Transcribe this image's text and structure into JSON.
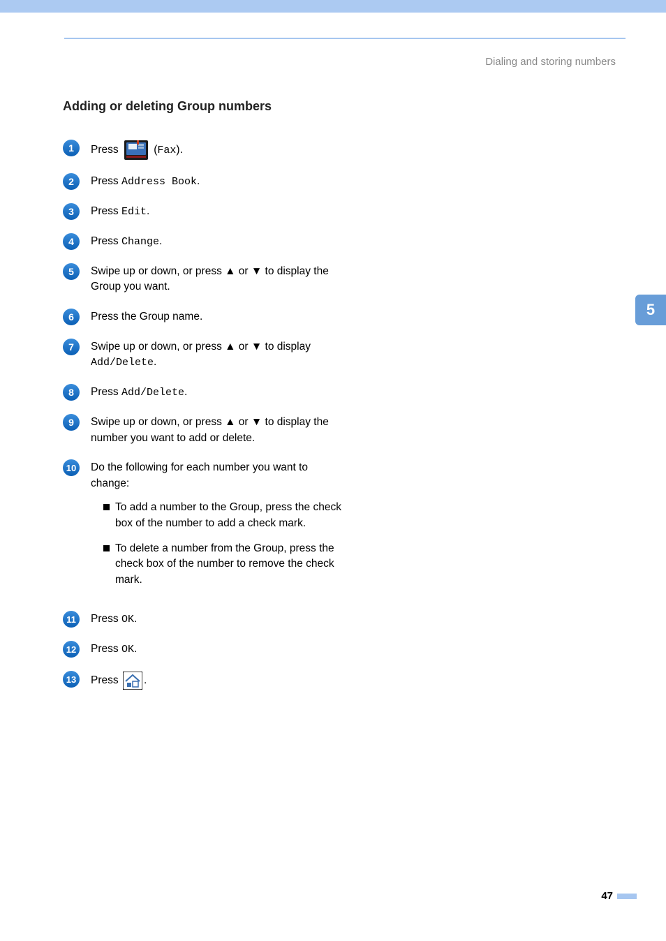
{
  "header": {
    "breadcrumb": "Dialing and storing numbers"
  },
  "section": {
    "title": "Adding or deleting Group numbers"
  },
  "steps": [
    {
      "num": "1",
      "prefix": "Press ",
      "fax_icon": true,
      "middle": " (",
      "code": "Fax",
      "suffix": ")."
    },
    {
      "num": "2",
      "prefix": "Press ",
      "code": "Address Book",
      "suffix": "."
    },
    {
      "num": "3",
      "prefix": "Press ",
      "code": "Edit",
      "suffix": "."
    },
    {
      "num": "4",
      "prefix": "Press ",
      "code": "Change",
      "suffix": "."
    },
    {
      "num": "5",
      "text_full": "Swipe up or down, or press ▲ or ▼ to display the Group you want."
    },
    {
      "num": "6",
      "text_full": "Press the Group name."
    },
    {
      "num": "7",
      "prefix": "Swipe up or down, or press ▲ or ▼ to display ",
      "code": "Add/Delete",
      "suffix": "."
    },
    {
      "num": "8",
      "prefix": "Press ",
      "code": "Add/Delete",
      "suffix": "."
    },
    {
      "num": "9",
      "text_full": "Swipe up or down, or press ▲ or ▼ to display the number you want to add or delete."
    },
    {
      "num": "10",
      "text_full": "Do the following for each number you want to change:",
      "sublist": [
        "To add a number to the Group, press the check box of the number to add a check mark.",
        "To delete a number from the Group, press the check box of the number to remove the check mark."
      ]
    },
    {
      "num": "11",
      "prefix": "Press ",
      "code": "OK",
      "suffix": "."
    },
    {
      "num": "12",
      "prefix": "Press ",
      "code": "OK",
      "suffix": "."
    },
    {
      "num": "13",
      "prefix": "Press ",
      "home_icon": true,
      "suffix": "."
    }
  ],
  "side_tab": "5",
  "page_number": "47"
}
